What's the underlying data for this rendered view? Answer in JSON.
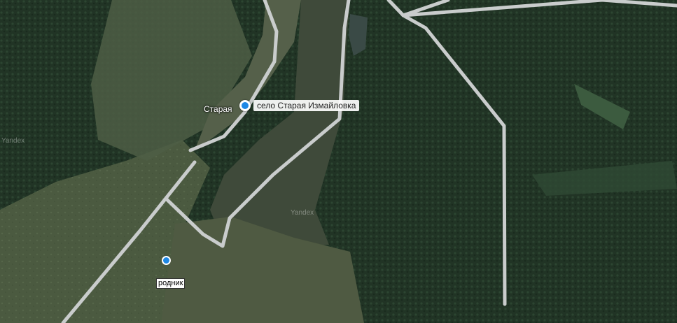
{
  "map": {
    "labels": {
      "village_partial": "Старая",
      "selected_place": "село Старая Измайловка",
      "spring": "родник"
    },
    "watermarks": [
      "Yandex",
      "Yandex"
    ],
    "colors": {
      "road": "#c9cccc",
      "marker_blue": "#1e88e5",
      "forest_dark": "#24382a",
      "field_light": "#4a5a3f"
    }
  }
}
